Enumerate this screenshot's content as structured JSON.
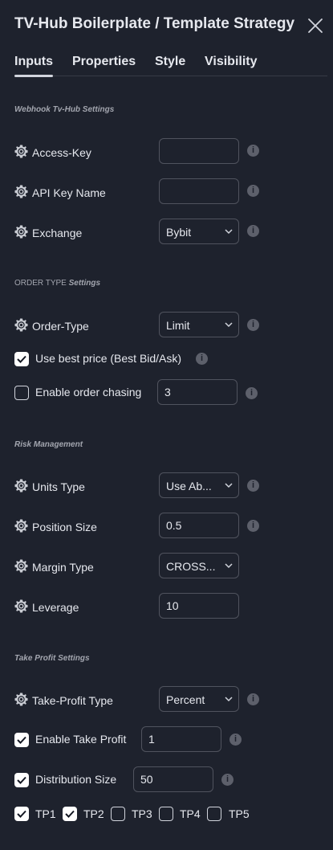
{
  "header": {
    "title": "TV-Hub Boilerplate / Template Strategy",
    "close_icon": "close-icon"
  },
  "tabs": [
    {
      "label": "Inputs",
      "active": true
    },
    {
      "label": "Properties"
    },
    {
      "label": "Style"
    },
    {
      "label": "Visibility"
    }
  ],
  "sections": {
    "webhook": "Webhook Tv-Hub Settings",
    "order_type_prefix": "ORDER TYPE",
    "order_type_suffix": "Settings",
    "risk": "Risk Management",
    "take_profit": "Take Profit Settings"
  },
  "webhook": {
    "access_key": {
      "label": "Access-Key",
      "value": ""
    },
    "api_key_name": {
      "label": "API Key Name",
      "value": ""
    },
    "exchange": {
      "label": "Exchange",
      "value": "Bybit"
    }
  },
  "order": {
    "order_type": {
      "label": "Order-Type",
      "value": "Limit"
    },
    "best_price": {
      "label": "Use best price (Best Bid/Ask)",
      "checked": true
    },
    "chasing": {
      "label": "Enable order chasing",
      "checked": false,
      "value": "3"
    }
  },
  "risk": {
    "units_type": {
      "label": "Units Type",
      "value": "Use Ab..."
    },
    "position_size": {
      "label": "Position Size",
      "value": "0.5"
    },
    "margin_type": {
      "label": "Margin Type",
      "value": "CROSS..."
    },
    "leverage": {
      "label": "Leverage",
      "value": "10"
    }
  },
  "take_profit": {
    "tp_type": {
      "label": "Take-Profit Type",
      "value": "Percent"
    },
    "enable": {
      "label": "Enable Take Profit",
      "checked": true,
      "value": "1"
    },
    "distribution": {
      "label": "Distribution Size",
      "checked": true,
      "value": "50"
    },
    "targets": [
      {
        "label": "TP1",
        "checked": true
      },
      {
        "label": "TP2",
        "checked": true
      },
      {
        "label": "TP3",
        "checked": false
      },
      {
        "label": "TP4",
        "checked": false
      },
      {
        "label": "TP5",
        "checked": false
      }
    ]
  },
  "colors": {
    "background": "#1e222d",
    "text": "#d1d4dc",
    "border": "#50535e",
    "info": "#5d606b"
  }
}
